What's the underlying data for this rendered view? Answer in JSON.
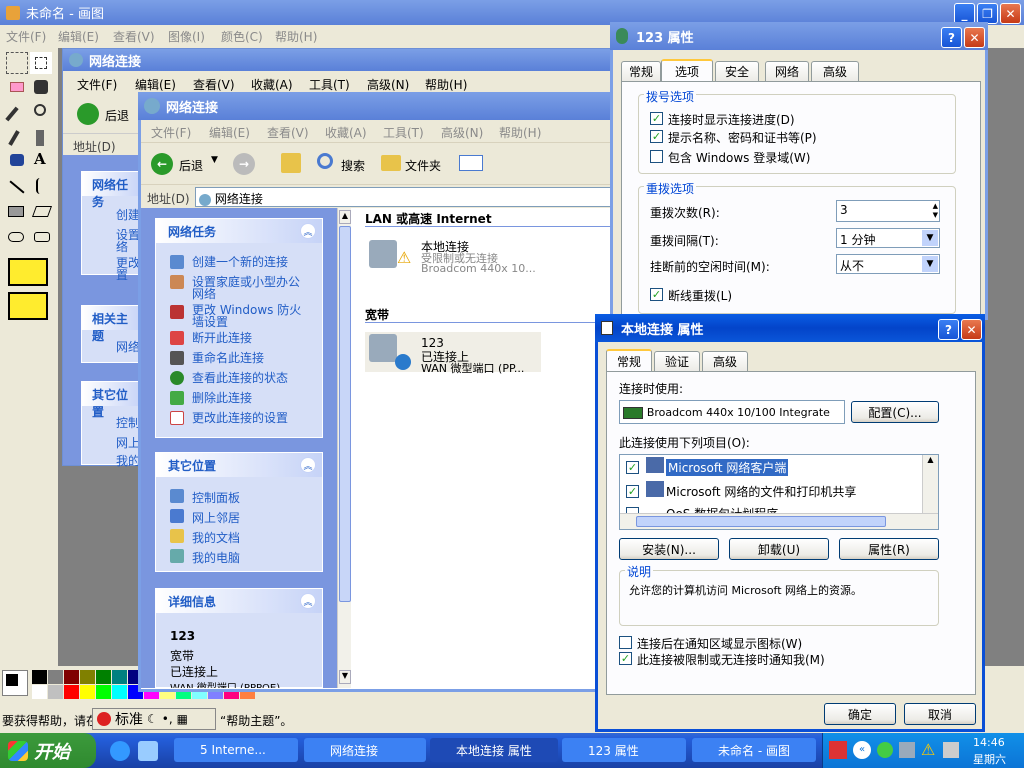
{
  "paint": {
    "title": "未命名 - 画图",
    "menu": [
      "文件(F)",
      "编辑(E)",
      "查看(V)",
      "图像(I)",
      "颜色(C)",
      "帮助(H)"
    ],
    "status": "要获得帮助，请在",
    "help_hint": "“帮助主题”。",
    "ime": "标准"
  },
  "net_back": {
    "title": "网络连接",
    "menu": [
      "文件(F)",
      "编辑(E)",
      "查看(V)",
      "收藏(A)",
      "工具(T)",
      "高级(N)",
      "帮助(H)"
    ],
    "back": "后退",
    "address": "地址(D)",
    "side": {
      "tasks": "网络任务",
      "t1": "创建",
      "t2": "设置",
      "t2b": "络",
      "t3": "更改",
      "t3b": "置",
      "related": "相关主题",
      "r1": "网络",
      "other": "其它位置",
      "o1": "控制",
      "o2": "网上",
      "o3": "我的"
    }
  },
  "net": {
    "title": "网络连接",
    "menu": [
      "文件(F)",
      "编辑(E)",
      "查看(V)",
      "收藏(A)",
      "工具(T)",
      "高级(N)",
      "帮助(H)"
    ],
    "back": "后退",
    "search": "搜索",
    "folders": "文件夹",
    "address_label": "地址(D)",
    "address": "网络连接",
    "tasks_title": "网络任务",
    "tasks": [
      "创建一个新的连接",
      "设置家庭或小型办公",
      "网络",
      "更改 Windows 防火",
      "墙设置",
      "断开此连接",
      "重命名此连接",
      "查看此连接的状态",
      "删除此连接",
      "更改此连接的设置"
    ],
    "other_title": "其它位置",
    "other": [
      "控制面板",
      "网上邻居",
      "我的文档",
      "我的电脑"
    ],
    "details_title": "详细信息",
    "details": [
      "123",
      "宽带",
      "已连接上",
      "WAN 微型端口 (PPPOE)"
    ],
    "group1": "LAN 或高速 Internet",
    "conn1": {
      "name": "本地连接",
      "status": "受限制或无连接",
      "device": "Broadcom 440x 10..."
    },
    "group2": "宽带",
    "conn2": {
      "name": "123",
      "status": "已连接上",
      "device": "WAN 微型端口 (PP..."
    }
  },
  "props123": {
    "title": "123 属性",
    "tabs": [
      "常规",
      "选项",
      "安全",
      "网络",
      "高级"
    ],
    "dial_group": "拨号选项",
    "c1": "连接时显示连接进度(D)",
    "c2": "提示名称、密码和证书等(P)",
    "c3": "包含 Windows 登录域(W)",
    "redial_group": "重拨选项",
    "r1": "重拨次数(R):",
    "r1v": "3",
    "r2": "重拨间隔(T):",
    "r2v": "1 分钟",
    "r3": "挂断前的空闲时间(M):",
    "r3v": "从不",
    "r4": "断线重拨(L)"
  },
  "local": {
    "title": "本地连接 属性",
    "tabs": [
      "常规",
      "验证",
      "高级"
    ],
    "connect_using": "连接时使用:",
    "adapter": "Broadcom 440x 10/100 Integrate",
    "configure": "配置(C)...",
    "items_label": "此连接使用下列项目(O):",
    "items": [
      "Microsoft 网络客户端",
      "Microsoft 网络的文件和打印机共享",
      "QoS 数据包计划程序"
    ],
    "install": "安装(N)...",
    "uninstall": "卸载(U)",
    "properties": "属性(R)",
    "desc_group": "说明",
    "desc": "允许您的计算机访问 Microsoft 网络上的资源。",
    "opt1": "连接后在通知区域显示图标(W)",
    "opt2": "此连接被限制或无连接时通知我(M)",
    "ok": "确定",
    "cancel": "取消"
  },
  "taskbar": {
    "start": "开始",
    "items": [
      "5 Interne...",
      "网络连接",
      "本地连接 属性",
      "123 属性",
      "未命名 - 画图"
    ],
    "time": "14:46",
    "day": "星期六"
  },
  "colors": {
    "xp_blue": "#0a5de4",
    "taskbar": "#245edb",
    "start": "#3c9a3c"
  }
}
